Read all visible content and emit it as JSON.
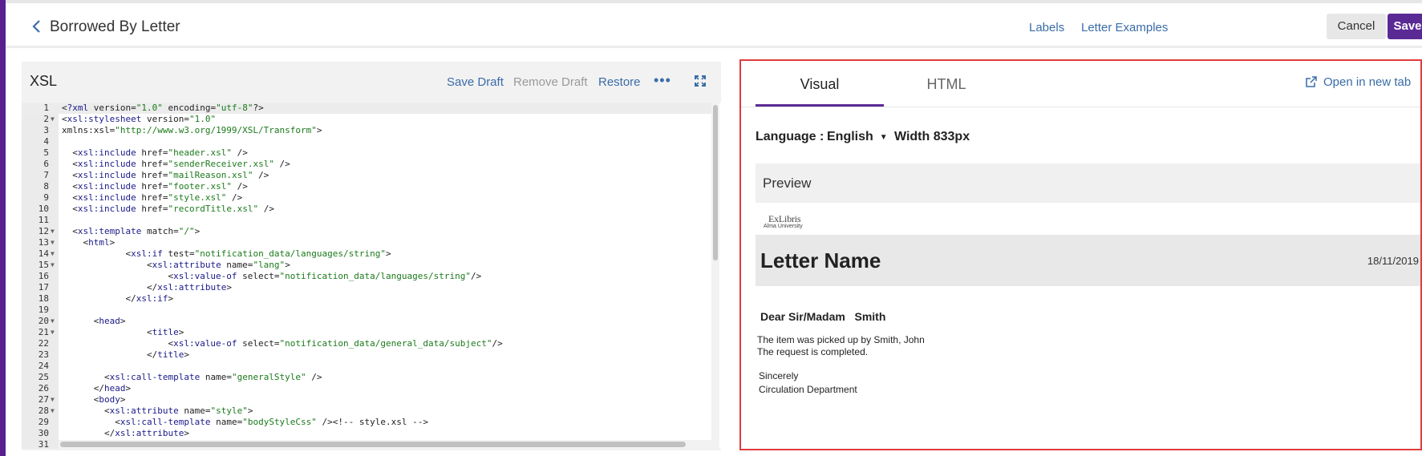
{
  "header": {
    "title": "Borrowed By Letter",
    "labels_link": "Labels",
    "examples_link": "Letter Examples",
    "cancel_label": "Cancel",
    "save_label": "Save"
  },
  "editor": {
    "title": "XSL",
    "save_draft": "Save Draft",
    "remove_draft": "Remove Draft",
    "restore": "Restore",
    "lines": [
      {
        "n": "1",
        "fold": false,
        "text": "<?xml version=\"1.0\" encoding=\"utf-8\"?>"
      },
      {
        "n": "2",
        "fold": true,
        "text": "<xsl:stylesheet version=\"1.0\""
      },
      {
        "n": "3",
        "fold": false,
        "text": "xmlns:xsl=\"http://www.w3.org/1999/XSL/Transform\">"
      },
      {
        "n": "4",
        "fold": false,
        "text": ""
      },
      {
        "n": "5",
        "fold": false,
        "text": "  <xsl:include href=\"header.xsl\" />"
      },
      {
        "n": "6",
        "fold": false,
        "text": "  <xsl:include href=\"senderReceiver.xsl\" />"
      },
      {
        "n": "7",
        "fold": false,
        "text": "  <xsl:include href=\"mailReason.xsl\" />"
      },
      {
        "n": "8",
        "fold": false,
        "text": "  <xsl:include href=\"footer.xsl\" />"
      },
      {
        "n": "9",
        "fold": false,
        "text": "  <xsl:include href=\"style.xsl\" />"
      },
      {
        "n": "10",
        "fold": false,
        "text": "  <xsl:include href=\"recordTitle.xsl\" />"
      },
      {
        "n": "11",
        "fold": false,
        "text": ""
      },
      {
        "n": "12",
        "fold": true,
        "text": "  <xsl:template match=\"/\">"
      },
      {
        "n": "13",
        "fold": true,
        "text": "    <html>"
      },
      {
        "n": "14",
        "fold": true,
        "text": "            <xsl:if test=\"notification_data/languages/string\">"
      },
      {
        "n": "15",
        "fold": true,
        "text": "                <xsl:attribute name=\"lang\">"
      },
      {
        "n": "16",
        "fold": false,
        "text": "                    <xsl:value-of select=\"notification_data/languages/string\"/>"
      },
      {
        "n": "17",
        "fold": false,
        "text": "                </xsl:attribute>"
      },
      {
        "n": "18",
        "fold": false,
        "text": "            </xsl:if>"
      },
      {
        "n": "19",
        "fold": false,
        "text": ""
      },
      {
        "n": "20",
        "fold": true,
        "text": "      <head>"
      },
      {
        "n": "21",
        "fold": true,
        "text": "                <title>"
      },
      {
        "n": "22",
        "fold": false,
        "text": "                    <xsl:value-of select=\"notification_data/general_data/subject\"/>"
      },
      {
        "n": "23",
        "fold": false,
        "text": "                </title>"
      },
      {
        "n": "24",
        "fold": false,
        "text": ""
      },
      {
        "n": "25",
        "fold": false,
        "text": "        <xsl:call-template name=\"generalStyle\" />"
      },
      {
        "n": "26",
        "fold": false,
        "text": "      </head>"
      },
      {
        "n": "27",
        "fold": true,
        "text": "      <body>"
      },
      {
        "n": "28",
        "fold": true,
        "text": "        <xsl:attribute name=\"style\">"
      },
      {
        "n": "29",
        "fold": false,
        "text": "          <xsl:call-template name=\"bodyStyleCss\" /><!-- style.xsl -->"
      },
      {
        "n": "30",
        "fold": false,
        "text": "        </xsl:attribute>"
      },
      {
        "n": "31",
        "fold": false,
        "text": ""
      }
    ]
  },
  "preview": {
    "tab_visual": "Visual",
    "tab_html": "HTML",
    "open_new_tab": "Open in new tab",
    "language_label": "Language :",
    "language_value": "English",
    "width_label": "Width 833px",
    "preview_title": "Preview",
    "logo_top": "ExLibris",
    "logo_bottom": "Alma University",
    "letter_name": "Letter Name",
    "letter_date": "18/11/2019",
    "dear_line": "Dear Sir/Madam   Smith",
    "body_line1": "The item was picked up by Smith, John",
    "body_line2": "The request is completed.",
    "sincerely": "Sincerely",
    "department": "Circulation Department"
  },
  "colors": {
    "accent": "#5a2a94",
    "link": "#3a6ca8",
    "highlight_border": "#e03c3c"
  }
}
